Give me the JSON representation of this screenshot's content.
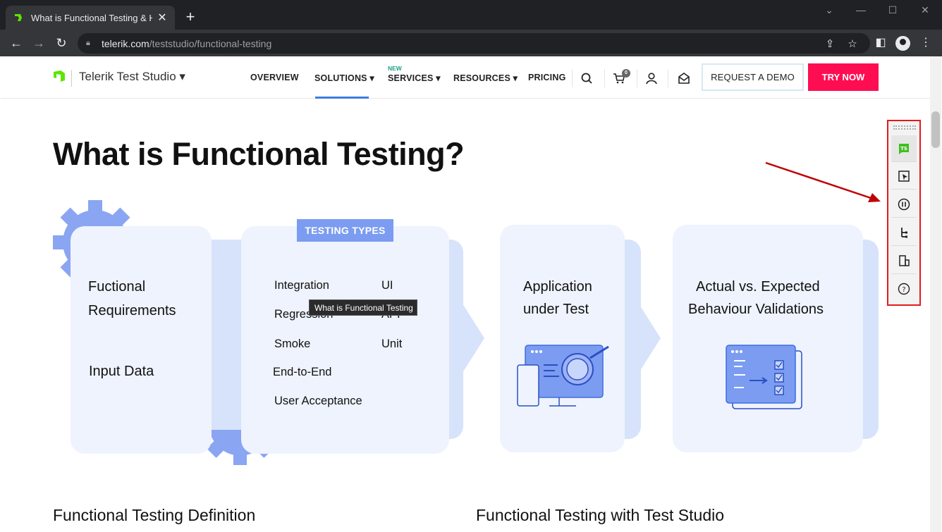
{
  "browser": {
    "tab_title": "What is Functional Testing & How",
    "tab_close": "✕",
    "new_tab": "+",
    "url_host": "telerik.com",
    "url_path": "/teststudio/functional-testing"
  },
  "site": {
    "brand": "Telerik Test Studio ▾",
    "nav": {
      "overview": "OVERVIEW",
      "solutions": "SOLUTIONS ▾",
      "services": "SERVICES ▾",
      "services_badge": "NEW",
      "resources": "RESOURCES ▾",
      "pricing": "PRICING"
    },
    "cart_count": "0",
    "request_demo": "REQUEST A DEMO",
    "try_now": "TRY NOW",
    "colors": {
      "accent": "#ff0d52",
      "nav_active": "#3d7de0",
      "card": "#eef3fd",
      "gear": "#8aa5f2"
    }
  },
  "content": {
    "title": "What is Functional Testing?",
    "card1": {
      "line1": "Fuctional",
      "line2": "Requirements",
      "line3": "Input Data"
    },
    "card2": {
      "label": "TESTING TYPES",
      "types_left": [
        "Integration",
        "Regression",
        "Smoke",
        "End-to-End",
        "User Acceptance"
      ],
      "types_right": [
        "UI",
        "API",
        "Unit"
      ]
    },
    "card3": {
      "line1": "Application",
      "line2": "under Test"
    },
    "card4": {
      "line1": "Actual vs. Expected",
      "line2": "Behaviour Validations"
    },
    "tooltip": "What is Functional Testing",
    "subhead_left": "Functional Testing Definition",
    "subhead_right": "Functional Testing with Test Studio"
  },
  "ts_toolbar": {
    "buttons": [
      "test-studio-logo-icon",
      "element-select-icon",
      "pause-icon",
      "dom-tree-icon",
      "dock-icon",
      "help-icon"
    ],
    "logo_text": "TS",
    "help_text": "?"
  }
}
